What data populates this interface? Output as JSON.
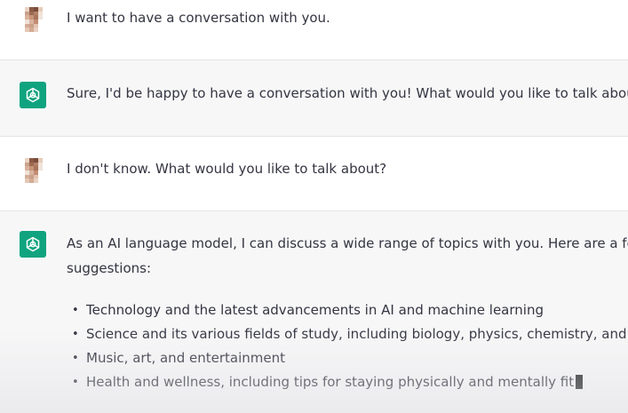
{
  "conversation": {
    "messages": [
      {
        "role": "user",
        "avatar": "user-avatar",
        "text": "I want to have a conversation with you."
      },
      {
        "role": "assistant",
        "avatar": "chatgpt-logo-icon",
        "text": "Sure, I'd be happy to have a conversation with you! What would you like to talk about?"
      },
      {
        "role": "user",
        "avatar": "user-avatar",
        "text": "I don't know. What would you like to talk about?"
      },
      {
        "role": "assistant",
        "avatar": "chatgpt-logo-icon",
        "intro_line1": "As an AI language model, I can discuss a wide range of topics with you. Here are a few",
        "intro_line2": "suggestions:",
        "bullets": [
          "Technology and the latest advancements in AI and machine learning",
          "Science and its various fields of study, including biology, physics, chemistry, and more",
          "Music, art, and entertainment",
          "Health and wellness, including tips for staying physically and mentally fit"
        ]
      }
    ]
  },
  "colors": {
    "assistant_row_bg": "#f7f7f8",
    "user_row_bg": "#ffffff",
    "chatgpt_green": "#10a37f",
    "text": "#343541",
    "divider": "#e5e5e7"
  }
}
